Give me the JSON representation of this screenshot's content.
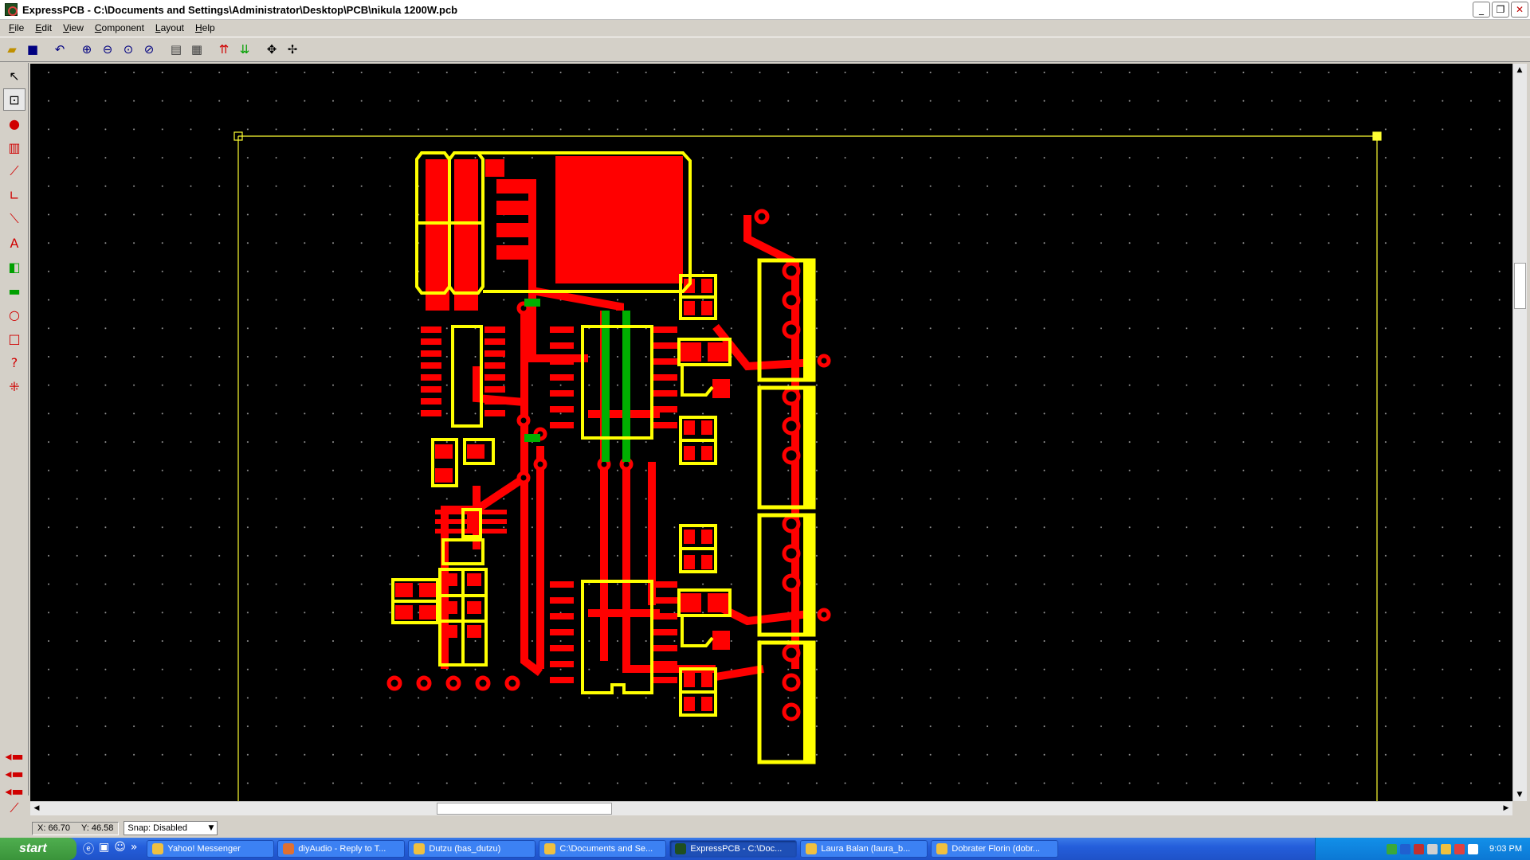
{
  "window": {
    "title": "ExpressPCB - C:\\Documents and Settings\\Administrator\\Desktop\\PCB\\nikula 1200W.pcb",
    "minimize_icon": "_",
    "maximize_icon": "❐",
    "close_icon": "✕"
  },
  "menu": [
    "File",
    "Edit",
    "View",
    "Component",
    "Layout",
    "Help"
  ],
  "toolbar_icons": [
    "open-icon",
    "save-icon",
    "undo-icon",
    "zoom-in-icon",
    "zoom-out-icon",
    "zoom-fit-icon",
    "zoom-previous-icon",
    "properties-icon",
    "place-component-icon",
    "top-layer-icon",
    "bottom-layer-icon",
    "pan-icon",
    "move-icon"
  ],
  "left_tools": [
    "pointer-icon",
    "zoom-tool-icon",
    "pad-icon",
    "component-icon",
    "trace-icon",
    "corner-icon",
    "diagonal-trace-icon",
    "text-icon",
    "layer-swap-icon",
    "part-icon",
    "circle-icon",
    "rectangle-icon",
    "query-icon",
    "node-icon"
  ],
  "status": {
    "x_label": "X: 66.70",
    "y_label": "Y: 46.58",
    "snap": "Snap: Disabled"
  },
  "taskbar": {
    "start": "start",
    "quicklaunch_more": "»",
    "tasks": [
      {
        "label": "Yahoo! Messenger",
        "active": false
      },
      {
        "label": "diyAudio - Reply to T...",
        "active": false
      },
      {
        "label": "Dutzu (bas_dutzu)",
        "active": false
      },
      {
        "label": "C:\\Documents and Se...",
        "active": false
      },
      {
        "label": "ExpressPCB - C:\\Doc...",
        "active": true
      },
      {
        "label": "Laura Balan (laura_b...",
        "active": false
      },
      {
        "label": "Dobrater Florin (dobr...",
        "active": false
      }
    ],
    "clock": "9:03 PM"
  },
  "colors": {
    "canvas": "#000000",
    "top_copper": "#ff0000",
    "silkscreen": "#ffff00",
    "bottom_copper": "#00a000"
  }
}
